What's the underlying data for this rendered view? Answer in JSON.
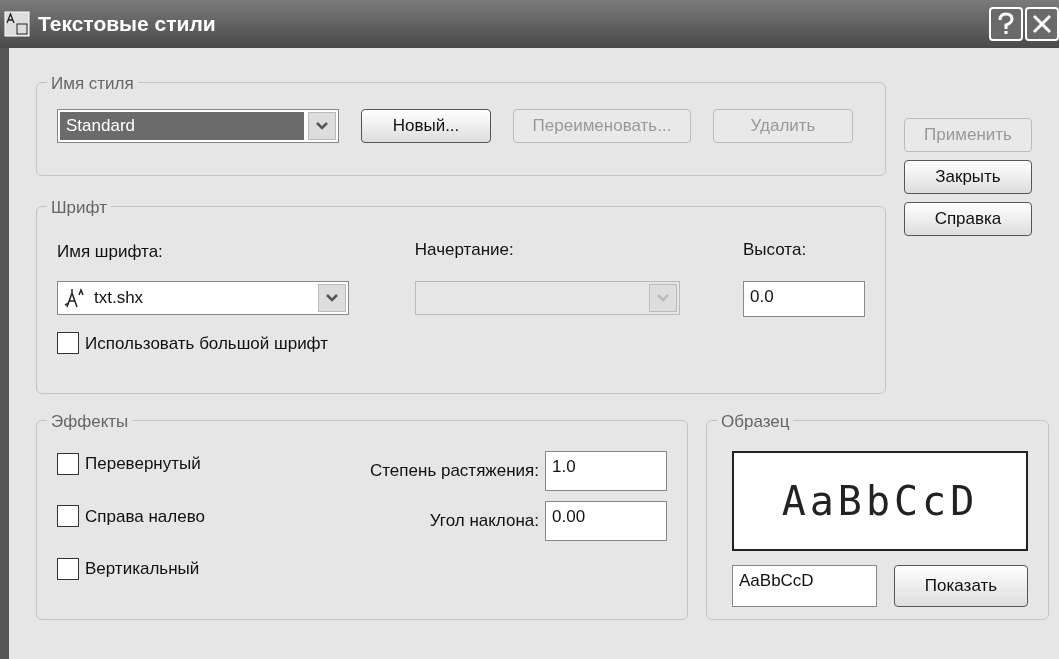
{
  "window": {
    "title": "Текстовые стили"
  },
  "style_name": {
    "label": "Имя стиля",
    "select": {
      "value": "Standard"
    },
    "buttons": [
      {
        "label": "Новый...",
        "disabled": false
      },
      {
        "label": "Переименовать...",
        "disabled": true
      },
      {
        "label": "Удалить",
        "disabled": true
      }
    ]
  },
  "side_buttons": [
    {
      "label": "Применить",
      "disabled": true
    },
    {
      "label": "Закрыть",
      "disabled": false
    },
    {
      "label": "Справка",
      "disabled": false
    }
  ],
  "font": {
    "label": "Шрифт",
    "font_name": {
      "label": "Имя шрифта:",
      "value": "txt.shx"
    },
    "style": {
      "label": "Начертание:",
      "disabled": true
    },
    "height": {
      "label": "Высота:",
      "value": "0.0"
    },
    "big_font": {
      "label": "Использовать большой шрифт",
      "checked": false
    }
  },
  "effects": {
    "label": "Эффекты",
    "checkboxes": [
      {
        "label": "Перевернутый",
        "checked": false
      },
      {
        "label": "Справа налево",
        "checked": false
      },
      {
        "label": "Вертикальный",
        "checked": false
      }
    ],
    "fields": [
      {
        "label": "Степень растяжения:",
        "value": "1.0"
      },
      {
        "label": "Угол наклона:",
        "value": "0.00"
      }
    ]
  },
  "sample": {
    "label": "Образец",
    "preview": "AaBbCcD",
    "field": {
      "value": "AaBbCcD"
    },
    "button": {
      "label": "Показать"
    }
  }
}
